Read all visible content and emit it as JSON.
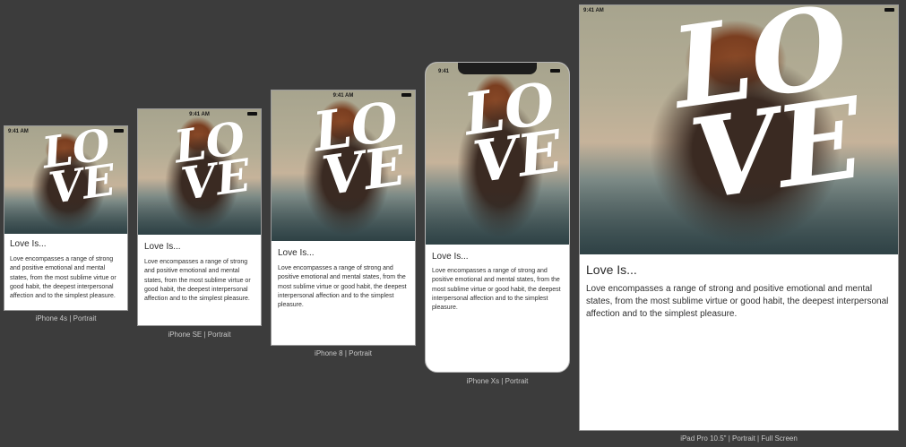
{
  "status_time": "9:41 AM",
  "status_time_short": "9:41",
  "hero_text": {
    "line1": "LO",
    "line2": "VE"
  },
  "content": {
    "heading": "Love Is...",
    "body": "Love encompasses a range of strong and positive emotional and mental states, from the most sublime virtue or good habit, the deepest interpersonal affection and to the simplest pleasure."
  },
  "devices": [
    {
      "caption": "iPhone 4s | Portrait"
    },
    {
      "caption": "iPhone SE | Portrait"
    },
    {
      "caption": "iPhone 8 | Portrait"
    },
    {
      "caption": "iPhone Xs | Portrait"
    },
    {
      "caption": "iPad Pro 10.5\" | Portrait | Full Screen"
    }
  ]
}
